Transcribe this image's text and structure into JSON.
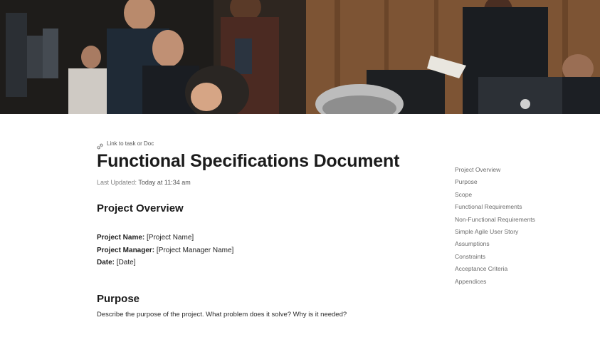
{
  "link": {
    "icon": "link-icon",
    "label": "Link to task or Doc"
  },
  "document": {
    "title": "Functional Specifications Document",
    "last_updated_label": "Last Updated:",
    "last_updated_value": "Today at 11:34 am"
  },
  "sections": {
    "overview": {
      "heading": "Project Overview",
      "fields": [
        {
          "key": "Project Name:",
          "value": "[Project Name]"
        },
        {
          "key": "Project Manager:",
          "value": "[Project Manager Name]"
        },
        {
          "key": "Date:",
          "value": "[Date]"
        }
      ]
    },
    "purpose": {
      "heading": "Purpose",
      "body": "Describe the purpose of the project. What problem does it solve? Why is it needed?"
    }
  },
  "toc": {
    "items": [
      "Project Overview",
      "Purpose",
      "Scope",
      "Functional Requirements",
      "Non-Functional Requirements",
      "Simple Agile User Story",
      "Assumptions",
      "Constraints",
      "Acceptance Criteria",
      "Appendices"
    ]
  }
}
